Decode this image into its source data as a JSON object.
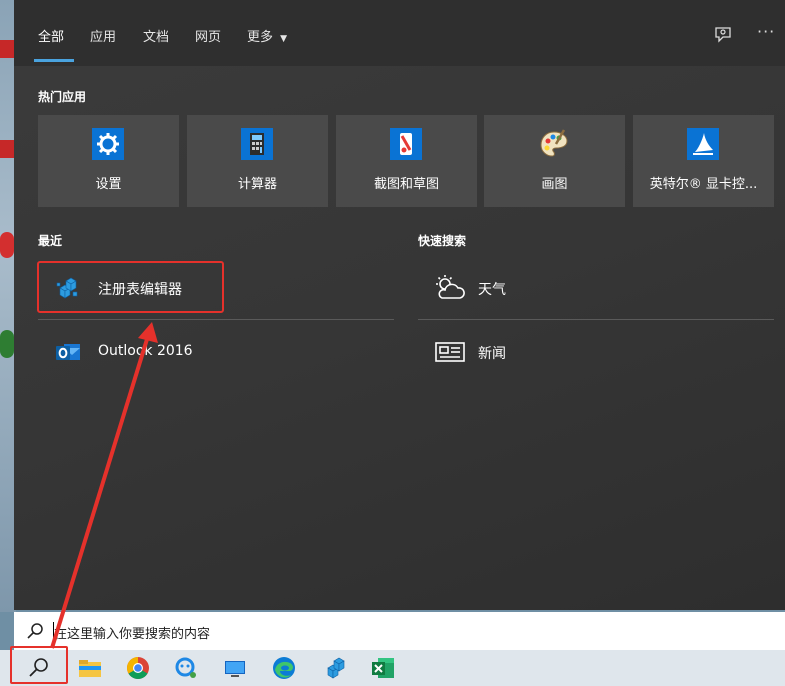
{
  "nav": {
    "tabs": [
      {
        "label": "全部",
        "active": true
      },
      {
        "label": "应用"
      },
      {
        "label": "文档"
      },
      {
        "label": "网页"
      },
      {
        "label": "更多"
      }
    ],
    "feedback_icon": "feedback-icon",
    "more_icon": "ellipsis-icon"
  },
  "top_apps": {
    "title": "热门应用",
    "items": [
      {
        "label": "设置",
        "icon": "gear-icon"
      },
      {
        "label": "计算器",
        "icon": "calculator-icon"
      },
      {
        "label": "截图和草图",
        "icon": "snip-sketch-icon"
      },
      {
        "label": "画图",
        "icon": "paint-icon"
      },
      {
        "label": "英特尔® 显卡控...",
        "icon": "intel-graphics-icon"
      }
    ]
  },
  "recent": {
    "title": "最近",
    "items": [
      {
        "label": "注册表编辑器",
        "icon": "regedit-icon"
      },
      {
        "label": "Outlook 2016",
        "icon": "outlook-icon"
      }
    ]
  },
  "quick_search": {
    "title": "快速搜索",
    "items": [
      {
        "label": "天气",
        "icon": "weather-icon"
      },
      {
        "label": "新闻",
        "icon": "news-icon"
      }
    ]
  },
  "search": {
    "placeholder": "在这里输入你要搜索的内容"
  },
  "colors": {
    "accent": "#4aa3df",
    "annotation": "#e5312b",
    "panel_bg": "#363636",
    "tile_bg": "#4a4a4a"
  }
}
